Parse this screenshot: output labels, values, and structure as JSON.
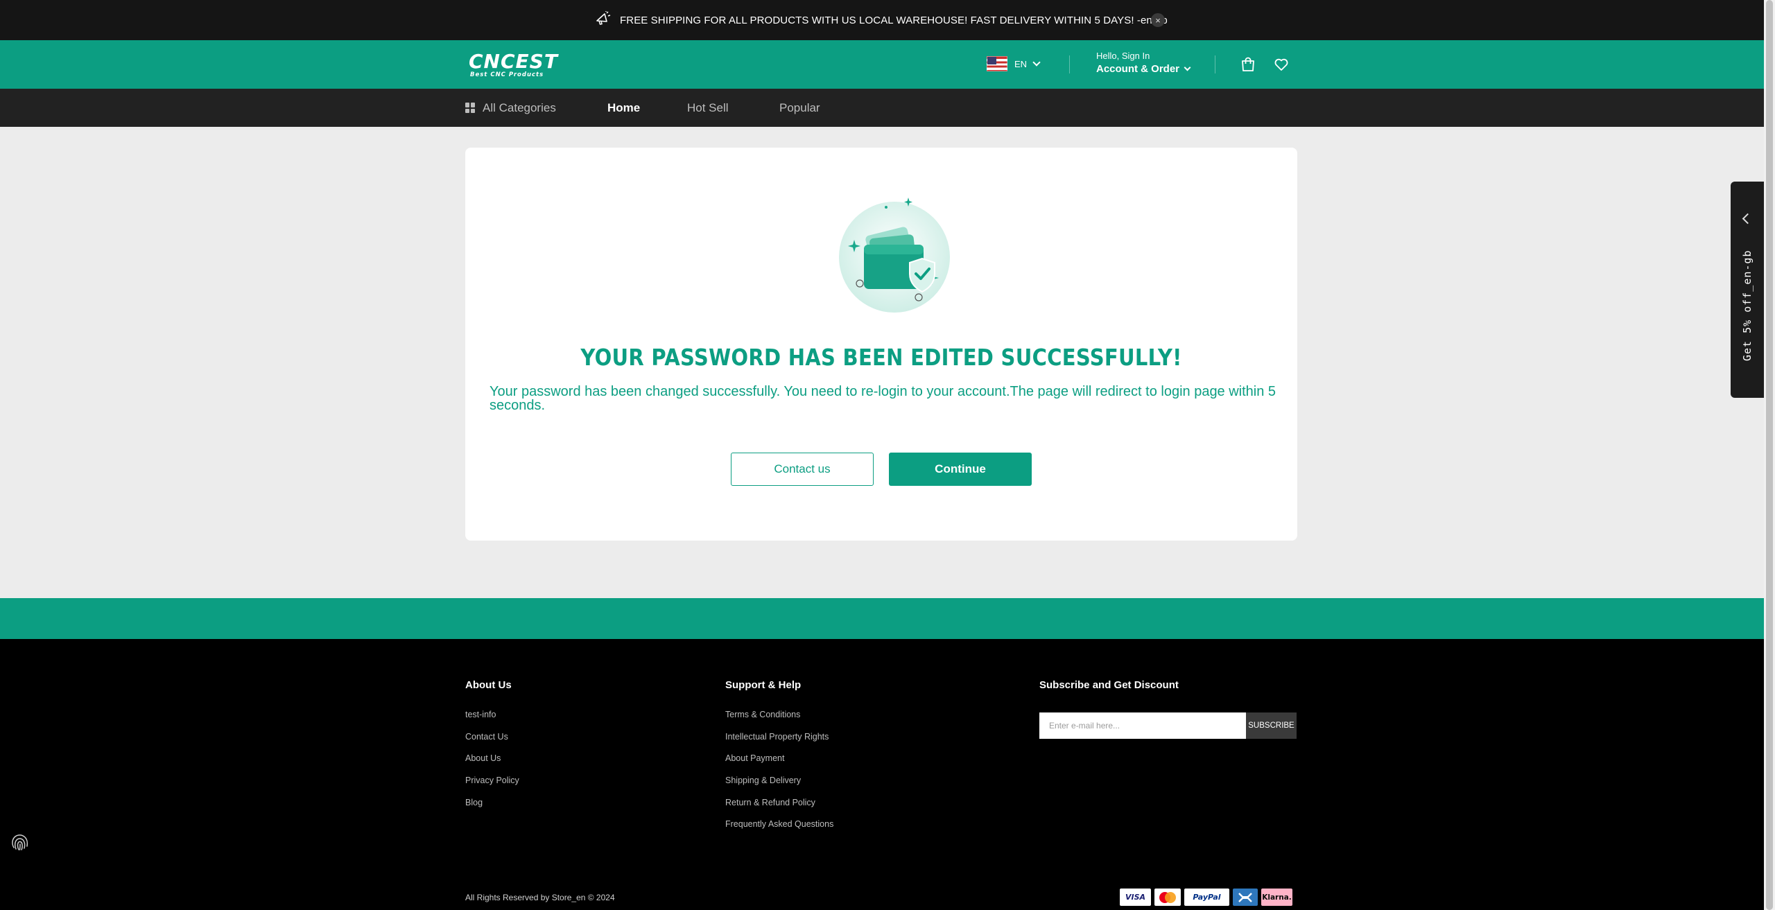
{
  "announcement": {
    "text": "FREE SHIPPING FOR ALL PRODUCTS WITH US LOCAL WAREHOUSE! FAST DELIVERY WITHIN 5 DAYS! -en-gb",
    "close_glyph": "×",
    "icon": "megaphone-icon"
  },
  "header": {
    "logo_text": "CNCEST",
    "logo_tagline": "Best CNC Products",
    "language": "EN",
    "flag": "us-flag-icon",
    "greeting": "Hello, Sign In",
    "account_label": "Account & Order",
    "icons": [
      "bag-icon",
      "heart-icon"
    ]
  },
  "nav": {
    "all_categories": "All Categories",
    "items": [
      "Home",
      "Hot Sell",
      "Popular"
    ],
    "active": "Home"
  },
  "main": {
    "illustration": "wallet-shield-check-icon",
    "title": "YOUR PASSWORD HAS BEEN EDITED SUCCESSFULLY!",
    "message": "Your password has been changed successfully. You need to re-login to your account.The page will redirect to login page within 5 seconds.",
    "contact_button": "Contact us",
    "continue_button": "Continue"
  },
  "side_tab": {
    "text": "Get 5% off_en-gb"
  },
  "footer": {
    "about_heading": "About Us",
    "about_links": [
      "test-info",
      "Contact Us",
      "About Us",
      "Privacy Policy",
      "Blog"
    ],
    "support_heading": "Support & Help",
    "support_links": [
      "Terms & Conditions",
      "Intellectual Property Rights",
      "About Payment",
      "Shipping & Delivery",
      "Return & Refund Policy",
      "Frequently Asked Questions"
    ],
    "subscribe_heading": "Subscribe and Get Discount",
    "email_placeholder": "Enter e-mail here...",
    "subscribe_button": "SUBSCRIBE",
    "copyright": "All Rights Reserved by Store_en © 2024",
    "payments": [
      "VISA",
      "Mastercard",
      "PayPal",
      "American Express",
      "Klarna."
    ],
    "payment_labels": {
      "visa": "VISA",
      "paypal": "PayPal",
      "klarna": "Klarna."
    }
  },
  "colors": {
    "brand_green": "#0c9e82",
    "top_bar": "#151515",
    "nav_bar": "#222222",
    "footer_bg": "#000000",
    "page_bg": "#ececec"
  }
}
